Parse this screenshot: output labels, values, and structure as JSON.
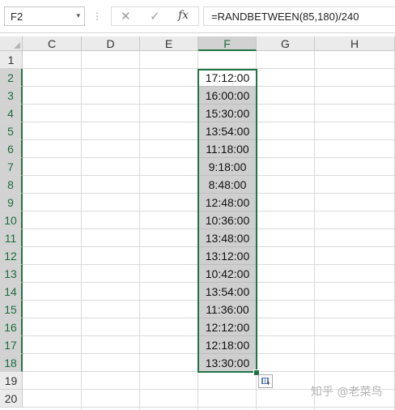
{
  "formula_bar": {
    "name_box": "F2",
    "name_box_arrow": "▾",
    "separator": "⋮",
    "cancel_icon": "✕",
    "enter_icon": "✓",
    "fx_icon": "fx",
    "formula": "=RANDBETWEEN(85,180)/240"
  },
  "columns": [
    "C",
    "D",
    "E",
    "F",
    "G",
    "H"
  ],
  "active_column": "F",
  "rows": [
    "1",
    "2",
    "3",
    "4",
    "5",
    "6",
    "7",
    "8",
    "9",
    "10",
    "11",
    "12",
    "13",
    "14",
    "15",
    "16",
    "17",
    "18",
    "19",
    "20"
  ],
  "cells_F": [
    "17:12:00",
    "16:00:00",
    "15:30:00",
    "13:54:00",
    "11:18:00",
    "9:18:00",
    "8:48:00",
    "12:48:00",
    "10:36:00",
    "13:48:00",
    "13:12:00",
    "10:42:00",
    "13:54:00",
    "11:36:00",
    "12:12:00",
    "12:18:00",
    "13:30:00"
  ],
  "colors": {
    "accent": "#217346",
    "selection_fill": "#cfcfcf"
  },
  "autofill_icon": "auto-fill-options-icon",
  "watermark": "知乎 @老菜鸟"
}
